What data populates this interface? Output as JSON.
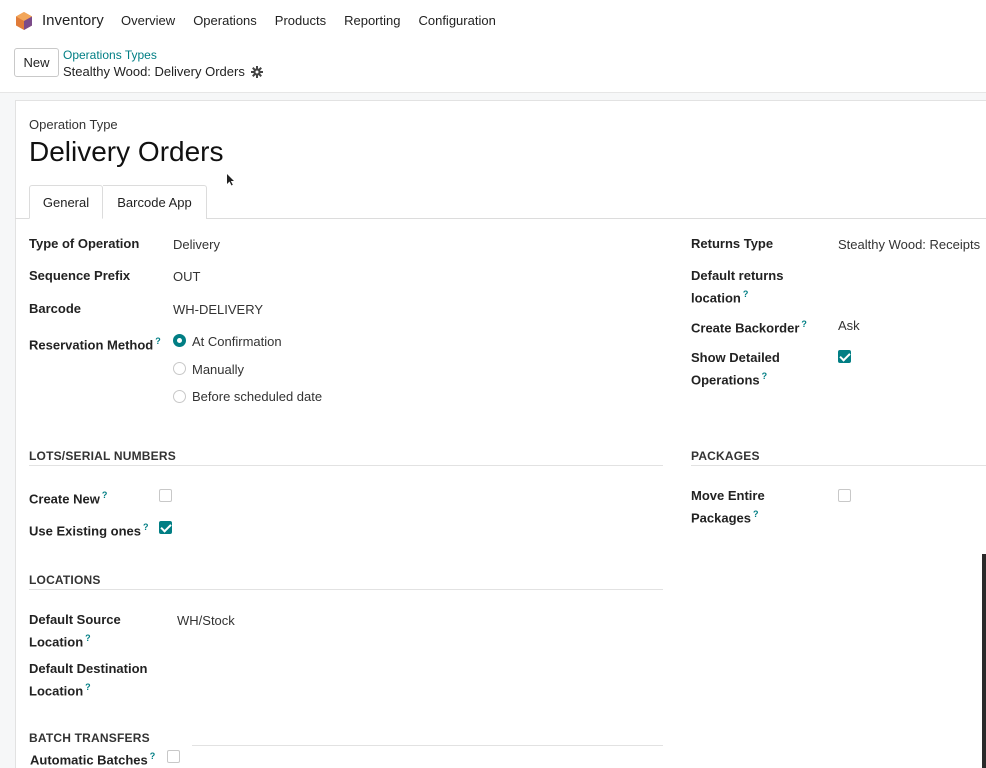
{
  "nav": {
    "app_name": "Inventory",
    "menu": [
      "Overview",
      "Operations",
      "Products",
      "Reporting",
      "Configuration"
    ]
  },
  "control": {
    "new_label": "New",
    "breadcrumb_parent": "Operations Types",
    "breadcrumb_current": "Stealthy Wood: Delivery Orders"
  },
  "form": {
    "type_label": "Operation Type",
    "title": "Delivery Orders",
    "tabs": [
      "General",
      "Barcode App"
    ],
    "left": {
      "type_of_operation": {
        "label": "Type of Operation",
        "value": "Delivery"
      },
      "sequence_prefix": {
        "label": "Sequence Prefix",
        "value": "OUT"
      },
      "barcode": {
        "label": "Barcode",
        "value": "WH-DELIVERY"
      },
      "reservation": {
        "label": "Reservation Method",
        "options": [
          "At Confirmation",
          "Manually",
          "Before scheduled date"
        ],
        "selected": "At Confirmation"
      }
    },
    "right": {
      "returns_type": {
        "label": "Returns Type",
        "value": "Stealthy Wood: Receipts"
      },
      "default_returns_location": {
        "label_1": "Default returns",
        "label_2": "location"
      },
      "create_backorder": {
        "label": "Create Backorder",
        "value": "Ask"
      },
      "show_detailed": {
        "label_1": "Show Detailed",
        "label_2": "Operations",
        "checked": true
      }
    },
    "lots": {
      "heading": "LOTS/SERIAL NUMBERS",
      "create_new": {
        "label": "Create New",
        "checked": false
      },
      "use_existing": {
        "label": "Use Existing ones",
        "checked": true
      }
    },
    "packages": {
      "heading": "PACKAGES",
      "move_entire": {
        "label_1": "Move Entire",
        "label_2": "Packages",
        "checked": false
      }
    },
    "locations": {
      "heading": "LOCATIONS",
      "source": {
        "label_1": "Default Source",
        "label_2": "Location",
        "value": "WH/Stock"
      },
      "destination": {
        "label_1": "Default Destination",
        "label_2": "Location"
      }
    },
    "batch": {
      "heading": "BATCH TRANSFERS",
      "automatic": {
        "label": "Automatic Batches",
        "checked": false
      }
    }
  },
  "colors": {
    "accent": "#017e84"
  }
}
